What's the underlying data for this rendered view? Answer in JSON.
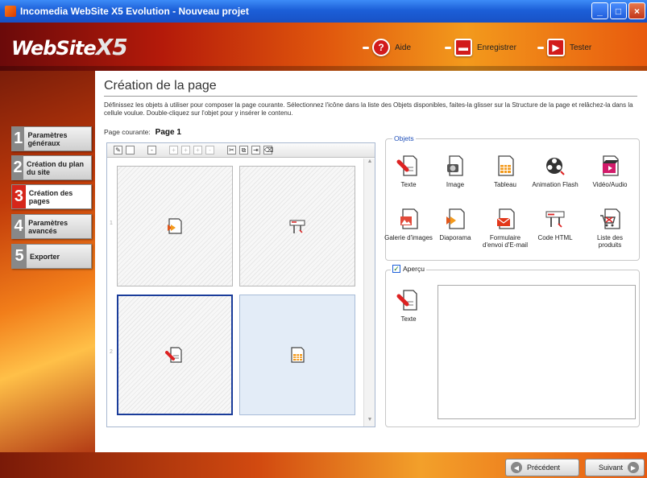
{
  "window": {
    "title": "Incomedia WebSite X5 Evolution - Nouveau projet"
  },
  "header": {
    "logo": "WebSite",
    "logo_suffix": "X5",
    "buttons": [
      {
        "label": "Aide",
        "icon": "help-icon"
      },
      {
        "label": "Enregistrer",
        "icon": "save-icon"
      },
      {
        "label": "Tester",
        "icon": "test-icon"
      }
    ]
  },
  "sidebar": {
    "items": [
      {
        "num": "1",
        "label": "Paramètres généraux"
      },
      {
        "num": "2",
        "label": "Création du plan du site"
      },
      {
        "num": "3",
        "label": "Création des pages",
        "active": true
      },
      {
        "num": "4",
        "label": "Paramètres avancés"
      },
      {
        "num": "5",
        "label": "Exporter"
      }
    ]
  },
  "main": {
    "title": "Création de la page",
    "description": "Définissez les objets à utiliser pour composer la page courante. Sélectionnez l'icône dans la liste des Objets disponibles, faites-la glisser sur la Structure de la page et relâchez-la dans la cellule voulue. Double-cliquez sur l'objet pour y insérer le contenu.",
    "current_page_label": "Page courante:",
    "current_page_value": "Page 1",
    "row_labels": [
      "1",
      "2"
    ],
    "cells": [
      {
        "icon": "slideshow-icon"
      },
      {
        "icon": "html-code-icon"
      },
      {
        "icon": "text-icon",
        "selected": true
      },
      {
        "icon": "table-icon"
      }
    ]
  },
  "objects": {
    "group_label": "Objets",
    "items": [
      {
        "label": "Texte",
        "icon": "text-icon"
      },
      {
        "label": "Image",
        "icon": "image-icon"
      },
      {
        "label": "Tableau",
        "icon": "table-icon"
      },
      {
        "label": "Animation Flash",
        "icon": "flash-icon"
      },
      {
        "label": "Vidéo/Audio",
        "icon": "video-audio-icon"
      },
      {
        "label": "Galerie d'images",
        "icon": "gallery-icon"
      },
      {
        "label": "Diaporama",
        "icon": "slideshow-icon"
      },
      {
        "label": "Formulaire d'envoi d'E-mail",
        "icon": "email-form-icon"
      },
      {
        "label": "Code HTML",
        "icon": "html-code-icon"
      },
      {
        "label": "Liste des produits",
        "icon": "product-list-icon"
      }
    ]
  },
  "preview": {
    "label": "Aperçu",
    "checked": true,
    "item_label": "Texte"
  },
  "footer": {
    "prev_label": "Précédent",
    "next_label": "Suivant"
  },
  "colors": {
    "accent": "#d6261a",
    "selection": "#1a3c9a",
    "titlebar": "#1c5fd8"
  }
}
